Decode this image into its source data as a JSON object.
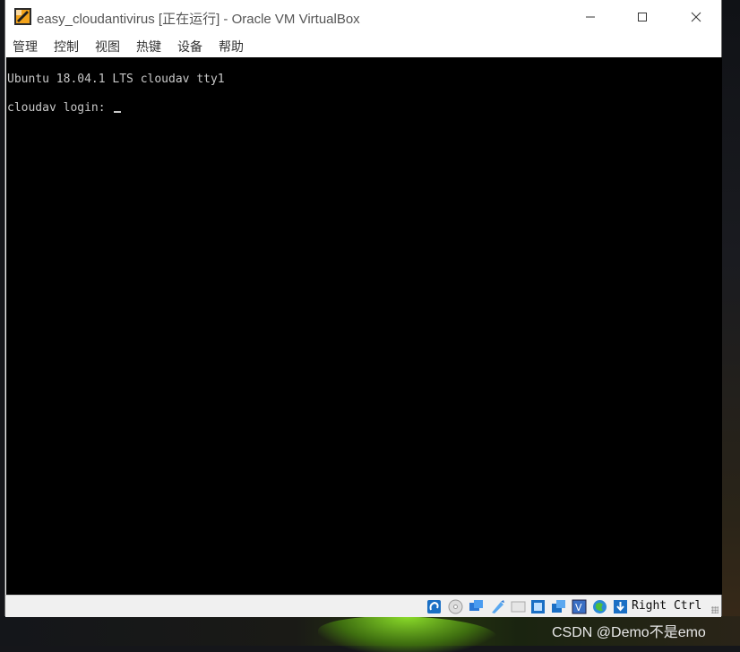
{
  "window": {
    "title": "easy_cloudantivirus [正在运行] - Oracle VM VirtualBox"
  },
  "menu": [
    "管理",
    "控制",
    "视图",
    "热键",
    "设备",
    "帮助"
  ],
  "console": {
    "line1": "Ubuntu 18.04.1 LTS cloudav tty1",
    "line2": "cloudav login: "
  },
  "status": {
    "host_key": "Right Ctrl",
    "icons": [
      "hard-disk-icon",
      "optical-drive-icon",
      "audio-icon",
      "network-icon",
      "usb-icon",
      "shared-folders-icon",
      "display-icon",
      "video-capture-icon",
      "recording-icon",
      "cpu-icon",
      "mouse-integration-icon",
      "keyboard-icon"
    ]
  },
  "watermark": "CSDN @Demo不是emo",
  "colors": {
    "titlebar": "#ffffff",
    "screen": "#000000",
    "terminal_text": "#c8c8c8",
    "statusbar": "#f0f0f0"
  }
}
